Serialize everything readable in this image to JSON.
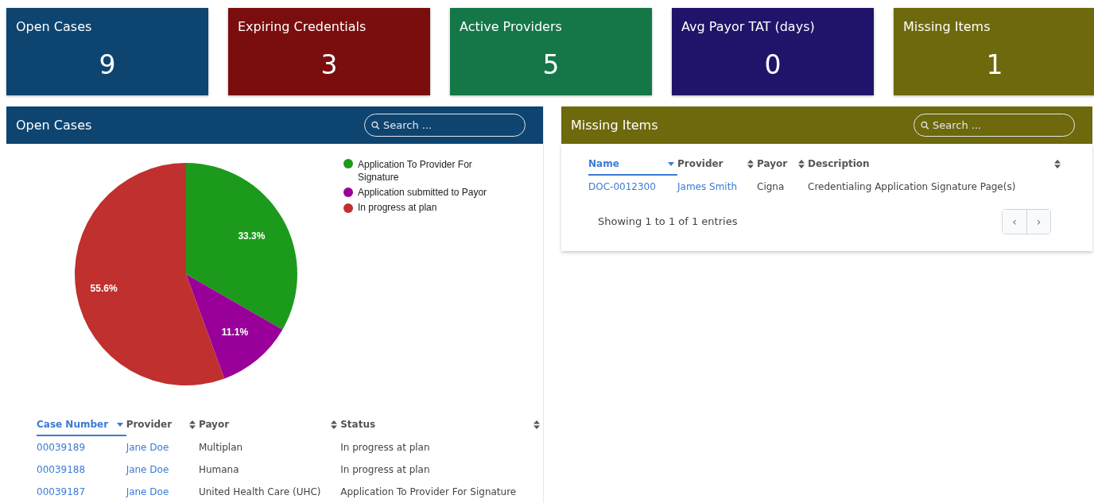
{
  "tiles": [
    {
      "label": "Open Cases",
      "value": "9",
      "color": "#0e4470"
    },
    {
      "label": "Expiring Credentials",
      "value": "3",
      "color": "#7a0e0f"
    },
    {
      "label": "Active Providers",
      "value": "5",
      "color": "#157747"
    },
    {
      "label": "Avg Payor TAT (days)",
      "value": "0",
      "color": "#1f146a"
    },
    {
      "label": "Missing Items",
      "value": "1",
      "color": "#6d690c"
    }
  ],
  "open_cases": {
    "title": "Open Cases",
    "search": {
      "placeholder": "Search ..."
    },
    "chart_data": {
      "type": "pie",
      "categories": [
        "Application To Provider For Signature",
        "Application submitted to Payor",
        "In progress at plan"
      ],
      "values": [
        33.3,
        11.1,
        55.6
      ],
      "colors": [
        "#1c9a1c",
        "#990099",
        "#c0302e"
      ],
      "value_labels": [
        "33.3%",
        "11.1%",
        "55.6%"
      ],
      "legend": "right"
    },
    "table": {
      "columns": [
        {
          "label": "Case Number",
          "sorted": true
        },
        {
          "label": "Provider",
          "sorted": false
        },
        {
          "label": "Payor",
          "sorted": false
        },
        {
          "label": "Status",
          "sorted": false
        }
      ],
      "rows": [
        [
          "00039189",
          "Jane Doe",
          "Multiplan",
          "In progress at plan"
        ],
        [
          "00039188",
          "Jane Doe",
          "Humana",
          "In progress at plan"
        ],
        [
          "00039187",
          "Jane Doe",
          "United Health Care (UHC)",
          "Application To Provider For Signature"
        ]
      ]
    }
  },
  "missing_items": {
    "title": "Missing Items",
    "search": {
      "placeholder": "Search ..."
    },
    "table": {
      "columns": [
        {
          "label": "Name",
          "sorted": true
        },
        {
          "label": "Provider",
          "sorted": false
        },
        {
          "label": "Payor",
          "sorted": false
        },
        {
          "label": "Description",
          "sorted": false
        }
      ],
      "rows": [
        [
          "DOC-0012300",
          "James Smith",
          "Cigna",
          "Credentialing Application Signature Page(s)"
        ]
      ]
    },
    "info": "Showing 1 to 1 of 1 entries",
    "pager": [
      {
        "label": "‹",
        "disabled": true
      },
      {
        "label": "›",
        "disabled": true
      }
    ]
  }
}
